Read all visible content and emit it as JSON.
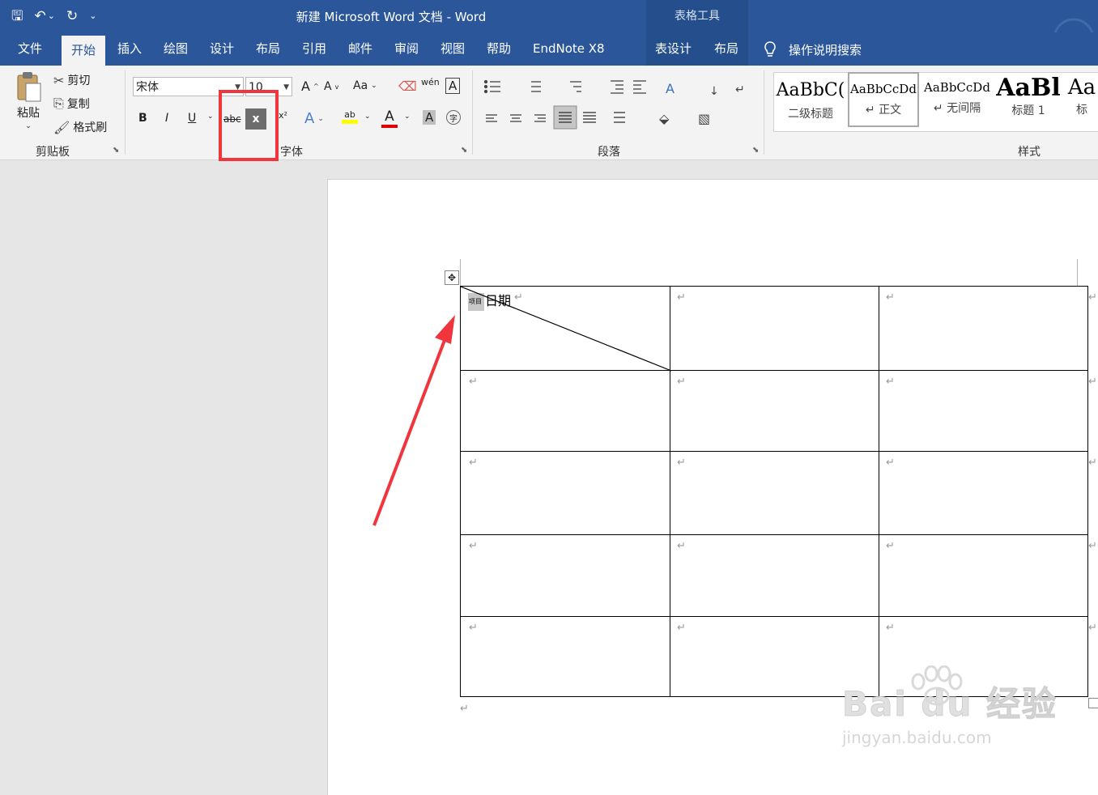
{
  "titlebar": {
    "doc_title": "新建 Microsoft Word 文档  -  Word",
    "context_header": "表格工具",
    "qat": {
      "save": "🖫",
      "undo": "↶",
      "undo_dd": "⌄",
      "redo": "↻",
      "customize": "⌄"
    }
  },
  "tabs": [
    "文件",
    "开始",
    "插入",
    "绘图",
    "设计",
    "布局",
    "引用",
    "邮件",
    "审阅",
    "视图",
    "帮助",
    "EndNote X8"
  ],
  "context_tabs": [
    "表设计",
    "布局"
  ],
  "tell_me": "操作说明搜索",
  "clipboard": {
    "paste": "粘贴",
    "cut": "剪切",
    "copy": "复制",
    "format_painter": "格式刷",
    "label": "剪贴板"
  },
  "font": {
    "name": "宋体",
    "size": "10",
    "label": "字体",
    "bold": "B",
    "italic": "I",
    "underline": "U",
    "strike": "abc",
    "subscript": "x",
    "superscript": "x²",
    "grow": "A",
    "shrink": "A",
    "case": "Aa",
    "phonetic": "wén",
    "char_border": "A",
    "text_effect": "A",
    "highlight": "ab",
    "font_color": "A",
    "char_shade": "A",
    "enclose": "字"
  },
  "paragraph": {
    "label": "段落"
  },
  "styles": {
    "label": "样式",
    "items": [
      {
        "sample": "AaBbC(",
        "name": "二级标题"
      },
      {
        "sample": "AaBbCcDd",
        "name": "↵ 正文"
      },
      {
        "sample": "AaBbCcDd",
        "name": "↵ 无间隔"
      },
      {
        "sample": "AaBl",
        "name": "标题 1"
      },
      {
        "sample": "Aa",
        "name": "标"
      }
    ]
  },
  "document": {
    "cell_small_text": "项目",
    "cell_main_text": "日期",
    "para_mark": "↵",
    "table_rows": 5,
    "table_cols": 3
  },
  "watermark": {
    "brand": "Bai du 经验",
    "url": "jingyan.baidu.com"
  },
  "colors": {
    "ribbon_blue": "#2b579a",
    "highlight_box": "#f0353d",
    "arrow": "#f0353d"
  }
}
